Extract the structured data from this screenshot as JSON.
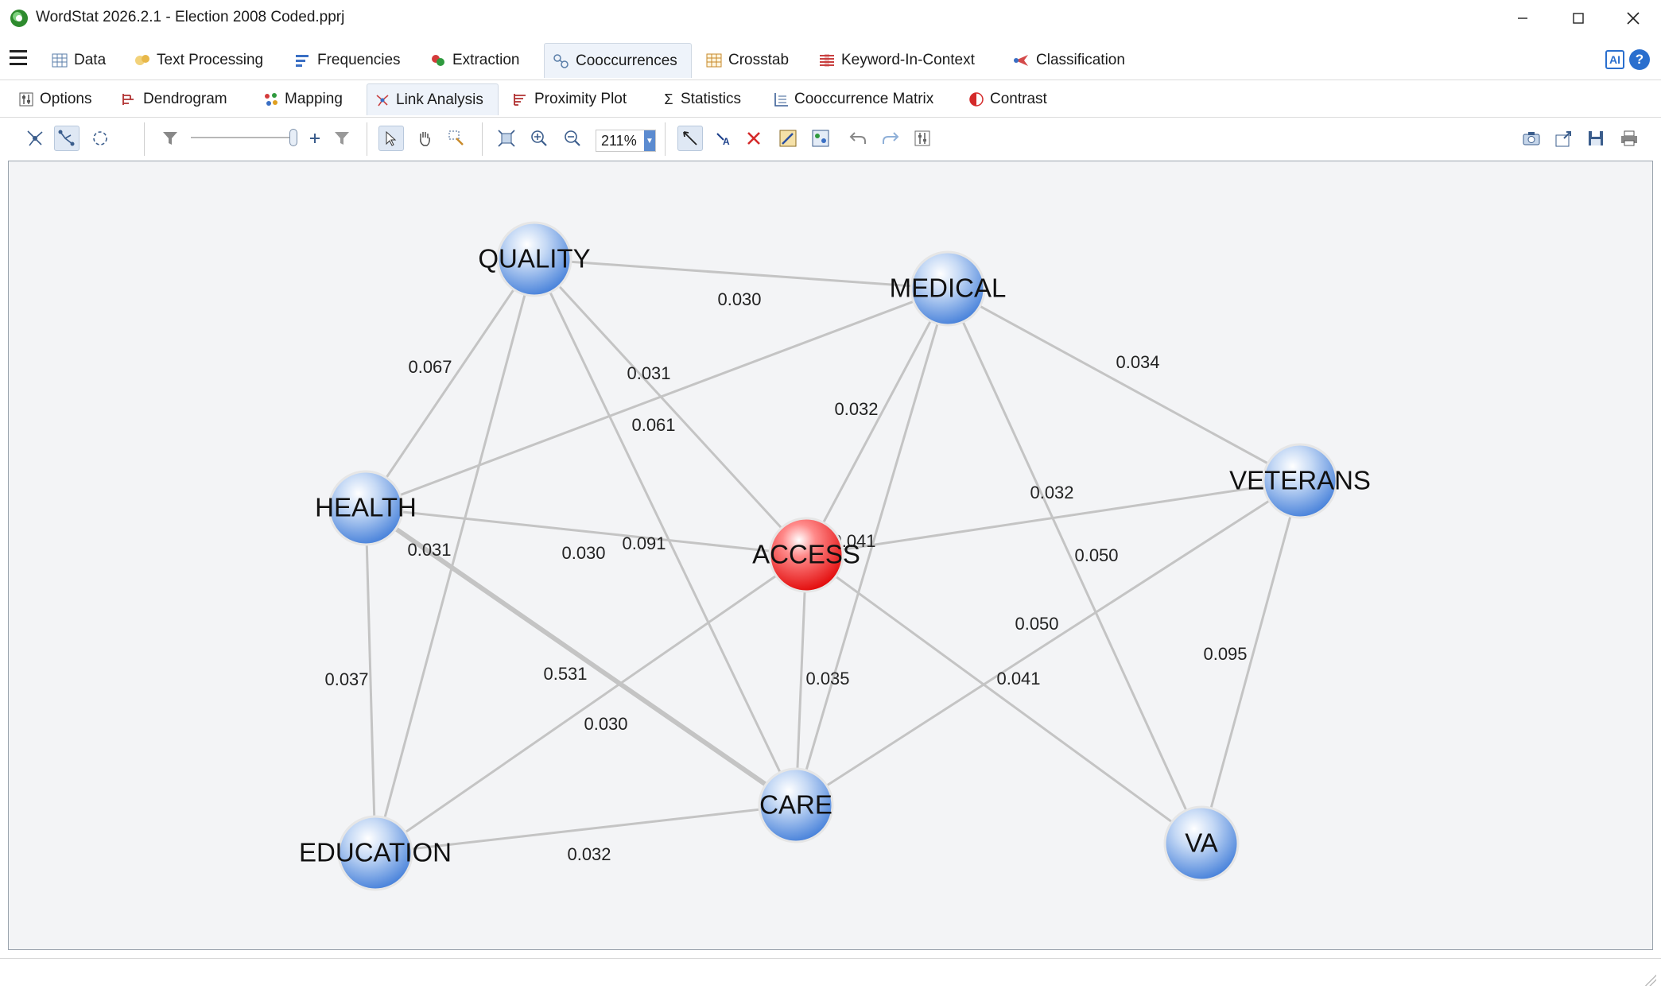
{
  "window": {
    "title": "WordStat 2026.2.1 - Election 2008 Coded.pprj"
  },
  "main_tabs": [
    {
      "label": "Data",
      "icon": "table-icon"
    },
    {
      "label": "Text Processing",
      "icon": "text-processing-icon"
    },
    {
      "label": "Frequencies",
      "icon": "frequencies-icon"
    },
    {
      "label": "Extraction",
      "icon": "extraction-icon"
    },
    {
      "label": "Cooccurrences",
      "icon": "cooccurrences-icon",
      "active": true
    },
    {
      "label": "Crosstab",
      "icon": "crosstab-icon"
    },
    {
      "label": "Keyword-In-Context",
      "icon": "kwic-icon"
    },
    {
      "label": "Classification",
      "icon": "classification-icon"
    }
  ],
  "ai_label": "AI",
  "help_label": "?",
  "sub_tabs": [
    {
      "label": "Options",
      "icon": "options-icon"
    },
    {
      "label": "Dendrogram",
      "icon": "dendrogram-icon"
    },
    {
      "label": "Mapping",
      "icon": "mapping-icon"
    },
    {
      "label": "Link Analysis",
      "icon": "link-analysis-icon",
      "active": true
    },
    {
      "label": "Proximity Plot",
      "icon": "proximity-plot-icon"
    },
    {
      "label": "Statistics",
      "icon": "sigma-icon"
    },
    {
      "label": "Cooccurrence Matrix",
      "icon": "matrix-icon"
    },
    {
      "label": "Contrast",
      "icon": "contrast-icon"
    }
  ],
  "toolbar": {
    "zoom": "211%"
  },
  "graph": {
    "nodes": [
      {
        "id": "QUALITY",
        "label": "QUALITY",
        "color": "blue"
      },
      {
        "id": "MEDICAL",
        "label": "MEDICAL",
        "color": "blue"
      },
      {
        "id": "HEALTH",
        "label": "HEALTH",
        "color": "blue"
      },
      {
        "id": "VETERANS",
        "label": "VETERANS",
        "color": "blue"
      },
      {
        "id": "ACCESS",
        "label": "ACCESS",
        "color": "red"
      },
      {
        "id": "CARE",
        "label": "CARE",
        "color": "blue"
      },
      {
        "id": "EDUCATION",
        "label": "EDUCATION",
        "color": "blue"
      },
      {
        "id": "VA",
        "label": "VA",
        "color": "blue"
      }
    ],
    "edges": [
      {
        "from": "QUALITY",
        "to": "MEDICAL",
        "weight": "0.030"
      },
      {
        "from": "QUALITY",
        "to": "HEALTH",
        "weight": "0.067"
      },
      {
        "from": "QUALITY",
        "to": "ACCESS",
        "weight": "0.031"
      },
      {
        "from": "QUALITY",
        "to": "CARE",
        "weight": "0.061"
      },
      {
        "from": "QUALITY",
        "to": "EDUCATION",
        "weight": "0.031"
      },
      {
        "from": "MEDICAL",
        "to": "ACCESS",
        "weight": "0.032"
      },
      {
        "from": "MEDICAL",
        "to": "VETERANS",
        "weight": "0.034"
      },
      {
        "from": "MEDICAL",
        "to": "HEALTH",
        "weight": "0.091"
      },
      {
        "from": "MEDICAL",
        "to": "VA",
        "weight": "0.050"
      },
      {
        "from": "MEDICAL",
        "to": "CARE",
        "weight": "0.035"
      },
      {
        "from": "HEALTH",
        "to": "ACCESS",
        "weight": "0.030"
      },
      {
        "from": "HEALTH",
        "to": "CARE",
        "weight": "0.531",
        "strong": true
      },
      {
        "from": "HEALTH",
        "to": "EDUCATION",
        "weight": "0.037"
      },
      {
        "from": "VETERANS",
        "to": "ACCESS",
        "weight": "0.032"
      },
      {
        "from": "VETERANS",
        "to": "CARE",
        "weight": "0.050"
      },
      {
        "from": "VETERANS",
        "to": "VA",
        "weight": "0.095"
      },
      {
        "from": "ACCESS",
        "to": "CARE",
        "weight": "0.041"
      },
      {
        "from": "ACCESS",
        "to": "VA",
        "weight": "0.041"
      },
      {
        "from": "ACCESS",
        "to": "EDUCATION",
        "weight": "0.030"
      },
      {
        "from": "CARE",
        "to": "EDUCATION",
        "weight": "0.032"
      }
    ]
  }
}
